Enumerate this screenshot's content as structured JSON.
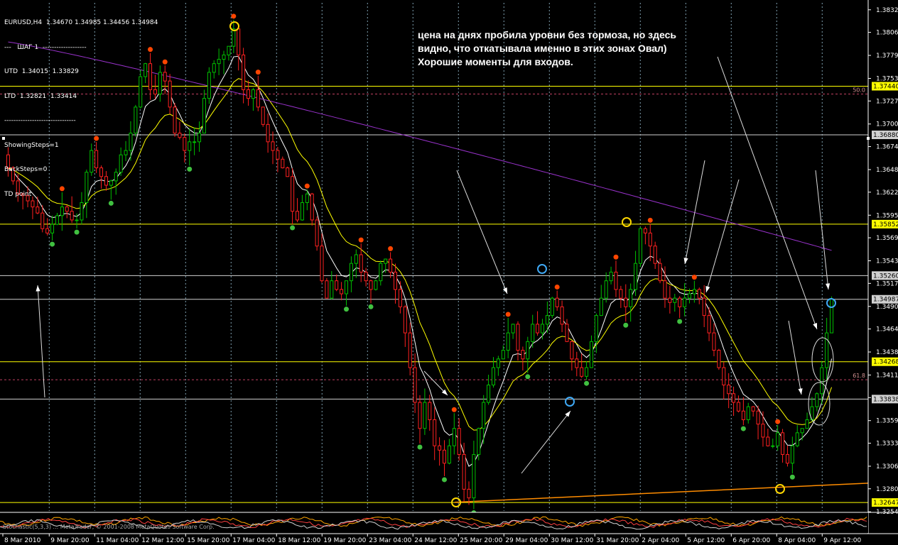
{
  "header": {
    "symbol": "EURUSD,H4",
    "ohlc": "1.34670 1.34985 1.34456 1.34984",
    "indicator_lines": [
      "---   ШАГ 1  -------------------",
      "UTD  1.34015  1.33829",
      "LTD  1.32821  1.33414",
      "-------------------------------",
      "ShowingSteps=1",
      "BackSteps=0",
      "TD point"
    ]
  },
  "comment": {
    "lines": [
      "цена на днях пробила уровни без тормоза, но здесь",
      "видно, что откатывала именно в этих зонах Овал)",
      "Хорошие моменты для входов."
    ]
  },
  "subwindow": {
    "label": "Stochastic(5,3,3) ... MetaTrader, © 2001-2008 MetaQuotes Software Corp."
  },
  "colors": {
    "background": "#000000",
    "bull": "#00c000",
    "bear": "#ff2020",
    "ma_fast": "#ffffff",
    "ma_mid": "#ffff00",
    "ma_slow": "#9932cc",
    "level_yellow": "#ffff00",
    "level_white": "#d0d0d0",
    "trend_orange": "#ff8c00",
    "fib_line": "#c04060",
    "grid": "#7fa0b0"
  },
  "chart_data": {
    "type": "candlestick",
    "title": "EURUSD,H4",
    "timeframe": "H4",
    "ylim": [
      1.3255,
      1.384
    ],
    "y_ticks": [
      "1.38320",
      "1.38060",
      "1.37795",
      "1.37530",
      "1.37270",
      "1.37005",
      "1.36745",
      "1.36480",
      "1.36220",
      "1.35955",
      "1.35695",
      "1.35430",
      "1.35170",
      "1.34905",
      "1.34645",
      "1.34380",
      "1.34115",
      "1.33855",
      "1.33590",
      "1.33330",
      "1.33065",
      "1.32805",
      "1.32540"
    ],
    "x_ticks": [
      "8 Mar 2010",
      "9 Mar 20:00",
      "11 Mar 04:00",
      "12 Mar 12:00",
      "15 Mar 20:00",
      "17 Mar 04:00",
      "18 Mar 12:00",
      "19 Mar 20:00",
      "23 Mar 04:00",
      "24 Mar 12:00",
      "25 Mar 20:00",
      "29 Mar 04:00",
      "30 Mar 12:00",
      "31 Mar 20:00",
      "2 Apr 04:00",
      "5 Apr 12:00",
      "6 Apr 20:00",
      "8 Apr 04:00",
      "9 Apr 12:00"
    ],
    "closes": [
      1.365,
      1.3635,
      1.362,
      1.3618,
      1.3612,
      1.3605,
      1.3598,
      1.358,
      1.3575,
      1.3585,
      1.3595,
      1.3605,
      1.36,
      1.359,
      1.359,
      1.361,
      1.3645,
      1.367,
      1.365,
      1.364,
      1.363,
      1.3635,
      1.3645,
      1.3665,
      1.367,
      1.369,
      1.372,
      1.3755,
      1.377,
      1.374,
      1.3735,
      1.376,
      1.375,
      1.372,
      1.369,
      1.3685,
      1.367,
      1.368,
      1.368,
      1.369,
      1.373,
      1.376,
      1.377,
      1.3775,
      1.378,
      1.379,
      1.381,
      1.378,
      1.374,
      1.373,
      1.374,
      1.372,
      1.37,
      1.368,
      1.367,
      1.366,
      1.365,
      1.364,
      1.36,
      1.359,
      1.361,
      1.362,
      1.359,
      1.356,
      1.352,
      1.35,
      1.352,
      1.351,
      1.3505,
      1.352,
      1.354,
      1.355,
      1.353,
      1.352,
      1.351,
      1.352,
      1.354,
      1.3545,
      1.353,
      1.351,
      1.349,
      1.346,
      1.342,
      1.338,
      1.335,
      1.338,
      1.336,
      1.333,
      1.3325,
      1.331,
      1.333,
      1.335,
      1.332,
      1.328,
      1.327,
      1.332,
      1.335,
      1.338,
      1.34,
      1.342,
      1.343,
      1.344,
      1.346,
      1.347,
      1.344,
      1.343,
      1.345,
      1.347,
      1.346,
      1.347,
      1.348,
      1.35,
      1.349,
      1.347,
      1.345,
      1.343,
      1.342,
      1.341,
      1.342,
      1.345,
      1.348,
      1.35,
      1.352,
      1.353,
      1.351,
      1.35,
      1.349,
      1.351,
      1.354,
      1.358,
      1.3575,
      1.356,
      1.354,
      1.352,
      1.35,
      1.3495,
      1.35,
      1.349,
      1.35,
      1.3505,
      1.351,
      1.35,
      1.348,
      1.346,
      1.344,
      1.342,
      1.34,
      1.339,
      1.338,
      1.337,
      1.336,
      1.3375,
      1.337,
      1.3355,
      1.334,
      1.333,
      1.333,
      1.3345,
      1.332,
      1.331,
      1.333,
      1.3345,
      1.335,
      1.336,
      1.3375,
      1.339,
      1.342,
      1.346,
      1.3499
    ],
    "horizontal_levels": [
      {
        "label": "1.37440",
        "value": 1.3744,
        "color": "yellow"
      },
      {
        "label": "1.36880",
        "value": 1.3688,
        "color": "white"
      },
      {
        "label": "1.35852",
        "value": 1.35852,
        "color": "yellow"
      },
      {
        "label": "1.35260",
        "value": 1.3526,
        "color": "white"
      },
      {
        "label": "1.34987",
        "value": 1.34987,
        "color": "white"
      },
      {
        "label": "1.34268",
        "value": 1.34268,
        "color": "yellow"
      },
      {
        "label": "1.33838",
        "value": 1.33838,
        "color": "white"
      },
      {
        "label": "1.32647",
        "value": 1.32647,
        "color": "yellow"
      }
    ],
    "fib_levels": [
      {
        "label": "50.0",
        "value": 1.3735
      },
      {
        "label": "61.8",
        "value": 1.3406
      }
    ],
    "moving_averages": [
      "white",
      "yellow",
      "purple"
    ],
    "grid": true
  }
}
